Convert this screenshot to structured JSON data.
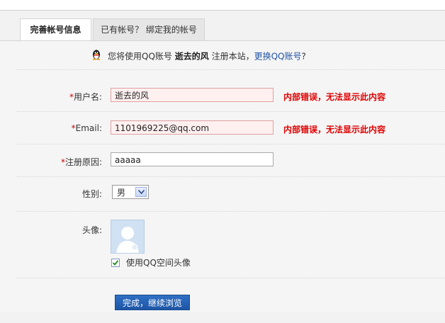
{
  "tabs": [
    {
      "label": "完善帐号信息",
      "active": true
    },
    {
      "label": "已有帐号？ 绑定我的帐号",
      "active": false
    }
  ],
  "notice": {
    "prefix": "您将使用QQ账号",
    "nickname": "逝去的风",
    "middle": "注册本站，",
    "link": "更换QQ账号",
    "suffix": "?"
  },
  "form": {
    "username": {
      "required_mark": "*",
      "label": "用户名:",
      "value": "逝去的风",
      "error": "内部错误，无法显示此内容"
    },
    "email": {
      "required_mark": "*",
      "label": "Email:",
      "value": "1101969225@qq.com",
      "error": "内部错误，无法显示此内容"
    },
    "reason": {
      "required_mark": "*",
      "label": "注册原因:",
      "value": "aaaaa"
    },
    "gender": {
      "label": "性别:",
      "value": "男"
    },
    "avatar": {
      "label": "头像:",
      "checkbox_label": "使用QQ空间头像",
      "checked": true
    },
    "submit_label": "完成，继续浏览"
  },
  "colors": {
    "error": "#e00000",
    "link": "#2255a4",
    "button": "#2a66b8"
  }
}
